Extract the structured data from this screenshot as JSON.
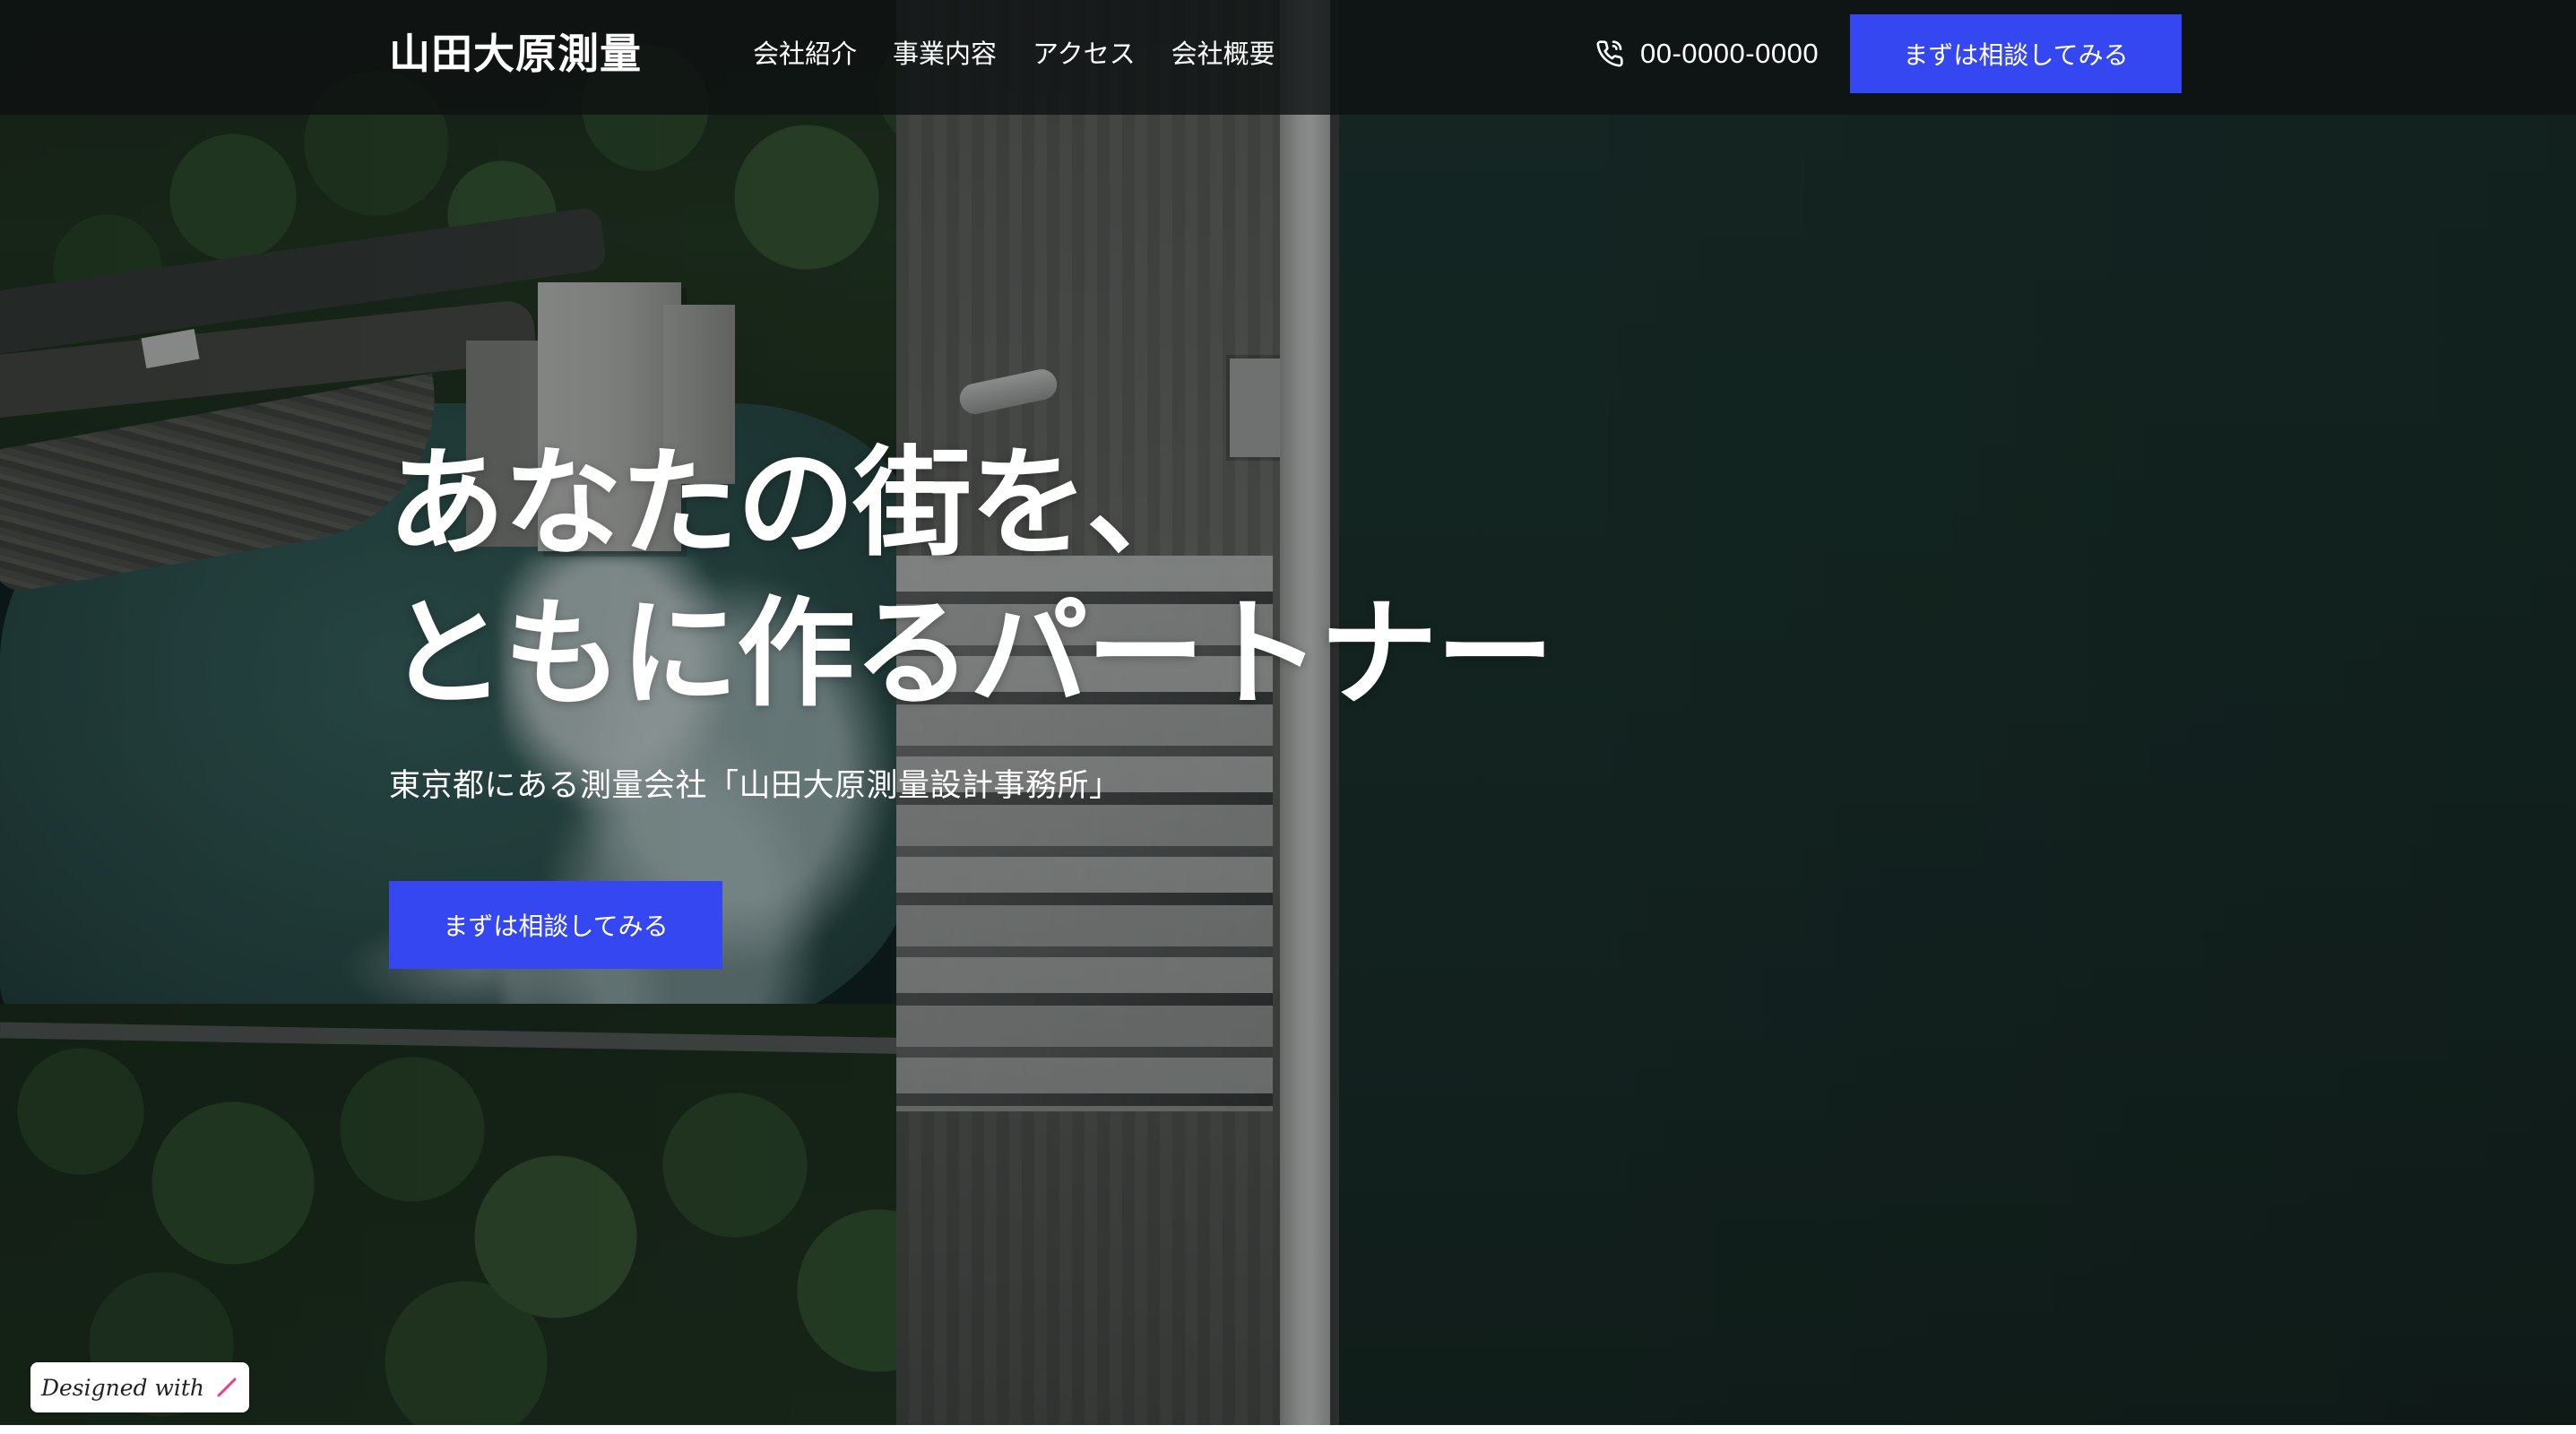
{
  "header": {
    "logo": "山田大原測量",
    "nav": [
      {
        "label": "会社紹介"
      },
      {
        "label": "事業内容"
      },
      {
        "label": "アクセス"
      },
      {
        "label": "会社概要"
      }
    ],
    "phone_icon": "phone-icon",
    "phone_number": "00-0000-0000",
    "cta_label": "まずは相談してみる"
  },
  "hero": {
    "headline_line1": "あなたの街を、",
    "headline_line2": "ともに作るパートナー",
    "subtitle": "東京都にある測量会社「山田大原測量設計事務所」",
    "cta_label": "まずは相談してみる",
    "background_image": "aerial view of dam and reservoir"
  },
  "badge": {
    "label": "Designed with",
    "icon": "pen-stroke-icon"
  },
  "colors": {
    "accent": "#3547f1",
    "header_bg": "#0e1212",
    "text": "#ffffff",
    "badge_icon": "#e5408a"
  }
}
